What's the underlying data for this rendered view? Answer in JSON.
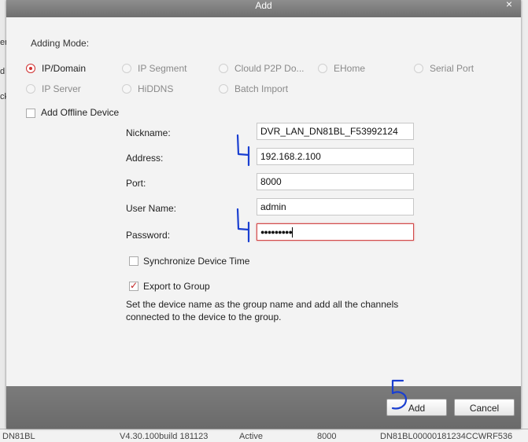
{
  "background": {
    "left_fragments": [
      "er",
      "d",
      "ck"
    ],
    "bottom_row": [
      "DN81BL",
      "V4.30.100build 181123",
      "Active",
      "8000",
      "DN81BL00000181234CCWRF536"
    ]
  },
  "dialog": {
    "title": "Add",
    "close_glyph": "×",
    "adding_mode_label": "Adding Mode:",
    "modes": [
      {
        "label": "IP/Domain",
        "checked": true,
        "enabled": true
      },
      {
        "label": "IP Segment",
        "checked": false,
        "enabled": false
      },
      {
        "label": "Clould P2P Do...",
        "checked": false,
        "enabled": false
      },
      {
        "label": "EHome",
        "checked": false,
        "enabled": false
      },
      {
        "label": "Serial Port",
        "checked": false,
        "enabled": false
      },
      {
        "label": "IP Server",
        "checked": false,
        "enabled": false
      },
      {
        "label": "HiDDNS",
        "checked": false,
        "enabled": false
      },
      {
        "label": "Batch Import",
        "checked": false,
        "enabled": false
      }
    ],
    "add_offline_label": "Add Offline Device",
    "form": {
      "nickname_label": "Nickname:",
      "nickname_value": "DVR_LAN_DN81BL_F53992124",
      "address_label": "Address:",
      "address_value": "192.168.2.100",
      "port_label": "Port:",
      "port_value": "8000",
      "username_label": "User Name:",
      "username_value": "admin",
      "password_label": "Password:",
      "password_value": "●●●●●●●●●"
    },
    "sync_time_label": "Synchronize Device Time",
    "export_group_label": "Export to Group",
    "export_group_checked": true,
    "description": "Set the device name as the group name and add all the channels connected to the device to the group.",
    "add_button": "Add",
    "cancel_button": "Cancel"
  },
  "annotations": {
    "color": "#1a3fd1",
    "marks": [
      "4",
      "4",
      "5"
    ]
  }
}
